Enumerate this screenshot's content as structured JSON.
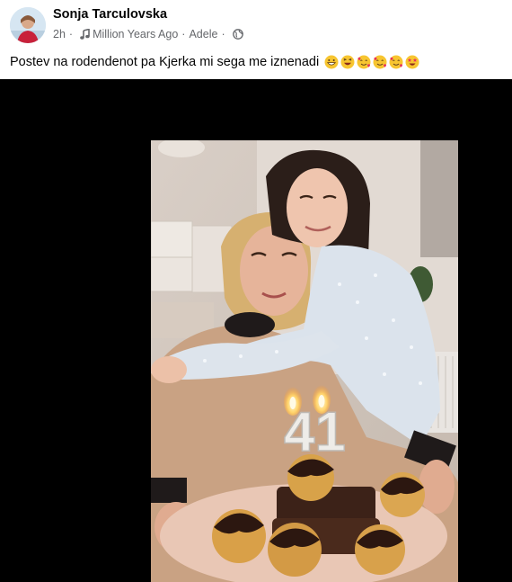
{
  "post": {
    "author": "Sonja Tarculovska",
    "time": "2h",
    "song": "Million Years Ago",
    "artist": "Adele",
    "separator": "·",
    "caption": "Postev na rodendenot pa Kjerka mi sega me iznenadi",
    "emojis": [
      "grinning-face",
      "laughing-face",
      "smiling-face-with-hearts",
      "smiling-face-with-hearts",
      "smiling-face-with-hearts",
      "star-struck-face"
    ]
  },
  "photo": {
    "candle_number": "41"
  },
  "icons": {
    "music": "music-note-icon",
    "audience": "globe-icon"
  },
  "colors": {
    "author_text": "#050505",
    "meta_text": "#65676b",
    "media_background": "#000000",
    "emoji_yellow": "#f7c530"
  }
}
